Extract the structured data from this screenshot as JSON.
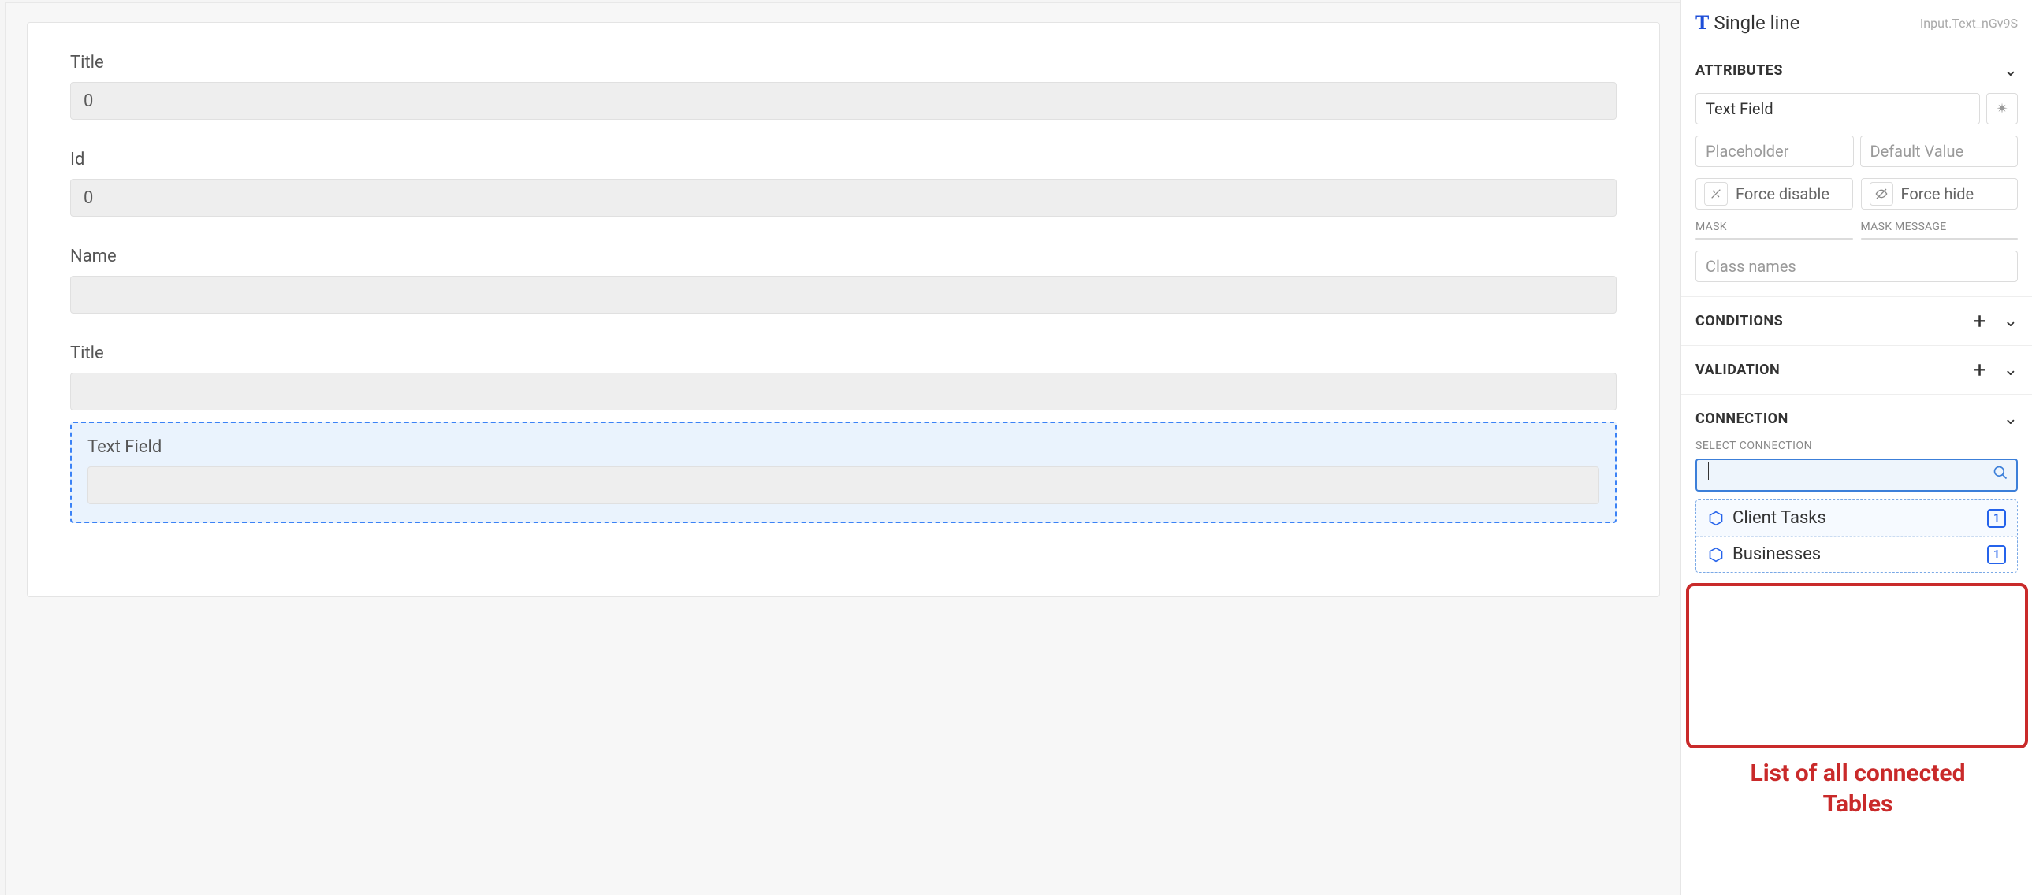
{
  "form": {
    "fields": [
      {
        "label": "Title",
        "value": "0"
      },
      {
        "label": "Id",
        "value": "0"
      },
      {
        "label": "Name",
        "value": ""
      },
      {
        "label": "Title",
        "value": ""
      }
    ],
    "selected": {
      "label": "Text Field",
      "value": ""
    }
  },
  "panel": {
    "header": {
      "icon": "T",
      "title": "Single line",
      "subtitle": "Input.Text_nGv9S"
    },
    "attributes": {
      "title": "ATTRIBUTES",
      "nameValue": "Text Field",
      "placeholderPH": "Placeholder",
      "defaultPH": "Default Value",
      "forceDisable": "Force disable",
      "forceHide": "Force hide",
      "maskLabel": "MASK",
      "maskMsgLabel": "MASK MESSAGE",
      "classPH": "Class names"
    },
    "conditions": {
      "title": "CONDITIONS"
    },
    "validation": {
      "title": "VALIDATION"
    },
    "connection": {
      "title": "CONNECTION",
      "selectLabel": "SELECT CONNECTION",
      "options": [
        {
          "label": "Client Tasks",
          "icon": "hex",
          "badge": "1"
        },
        {
          "label": "Businesses",
          "icon": "hex",
          "badge": "1"
        }
      ]
    }
  },
  "annotation": "List of all connected Tables"
}
